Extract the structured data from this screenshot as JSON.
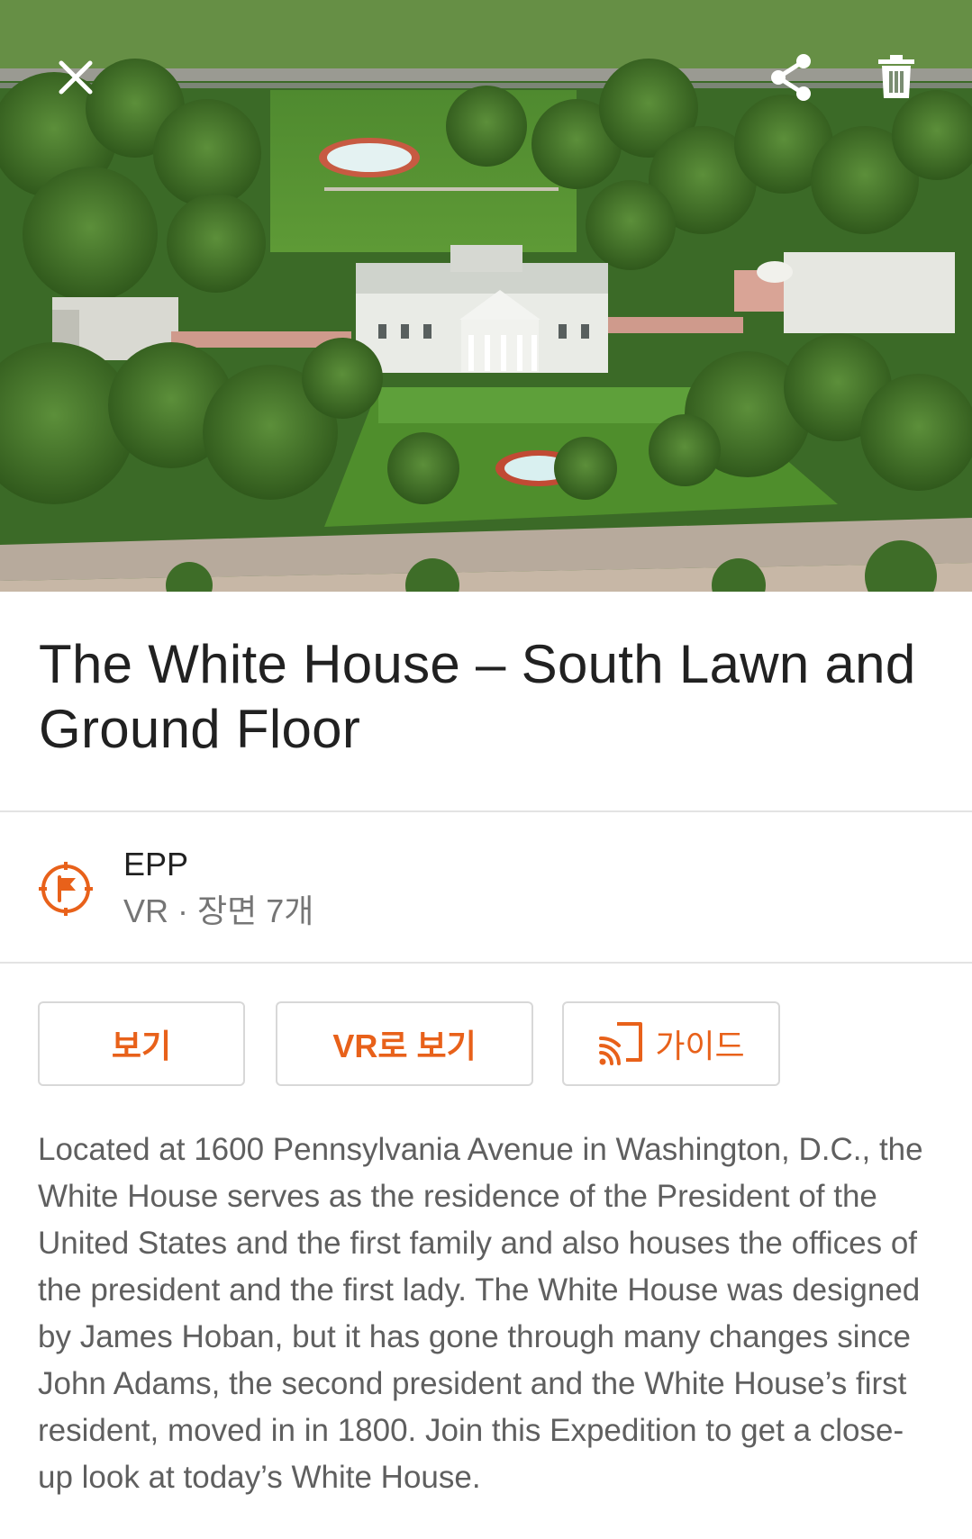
{
  "header": {
    "close_icon": "close-icon",
    "share_icon": "share-icon",
    "delete_icon": "trash-icon"
  },
  "hero": {
    "image_subject": "aerial-white-house"
  },
  "title": "The White House – South Lawn and Ground Floor",
  "author": {
    "name": "EPP",
    "meta": "VR · 장면 7개",
    "logo_icon": "compass-flag-icon",
    "logo_color": "#e8611a"
  },
  "actions": {
    "view_label": "보기",
    "vr_label": "VR로 보기",
    "guide_label": "가이드",
    "guide_icon": "cast-guide-icon",
    "accent_color": "#e8611a"
  },
  "description": "Located at 1600 Pennsylvania Avenue in Washington, D.C., the White House serves as the residence of the President of the United States and the first family and also houses the offices of the president and the first lady. The White House was designed by James Hoban, but it has gone through many changes since John Adams, the second president and the White House’s first resident, moved in in 1800. Join this Expedition to get a close-up look at today’s White House."
}
